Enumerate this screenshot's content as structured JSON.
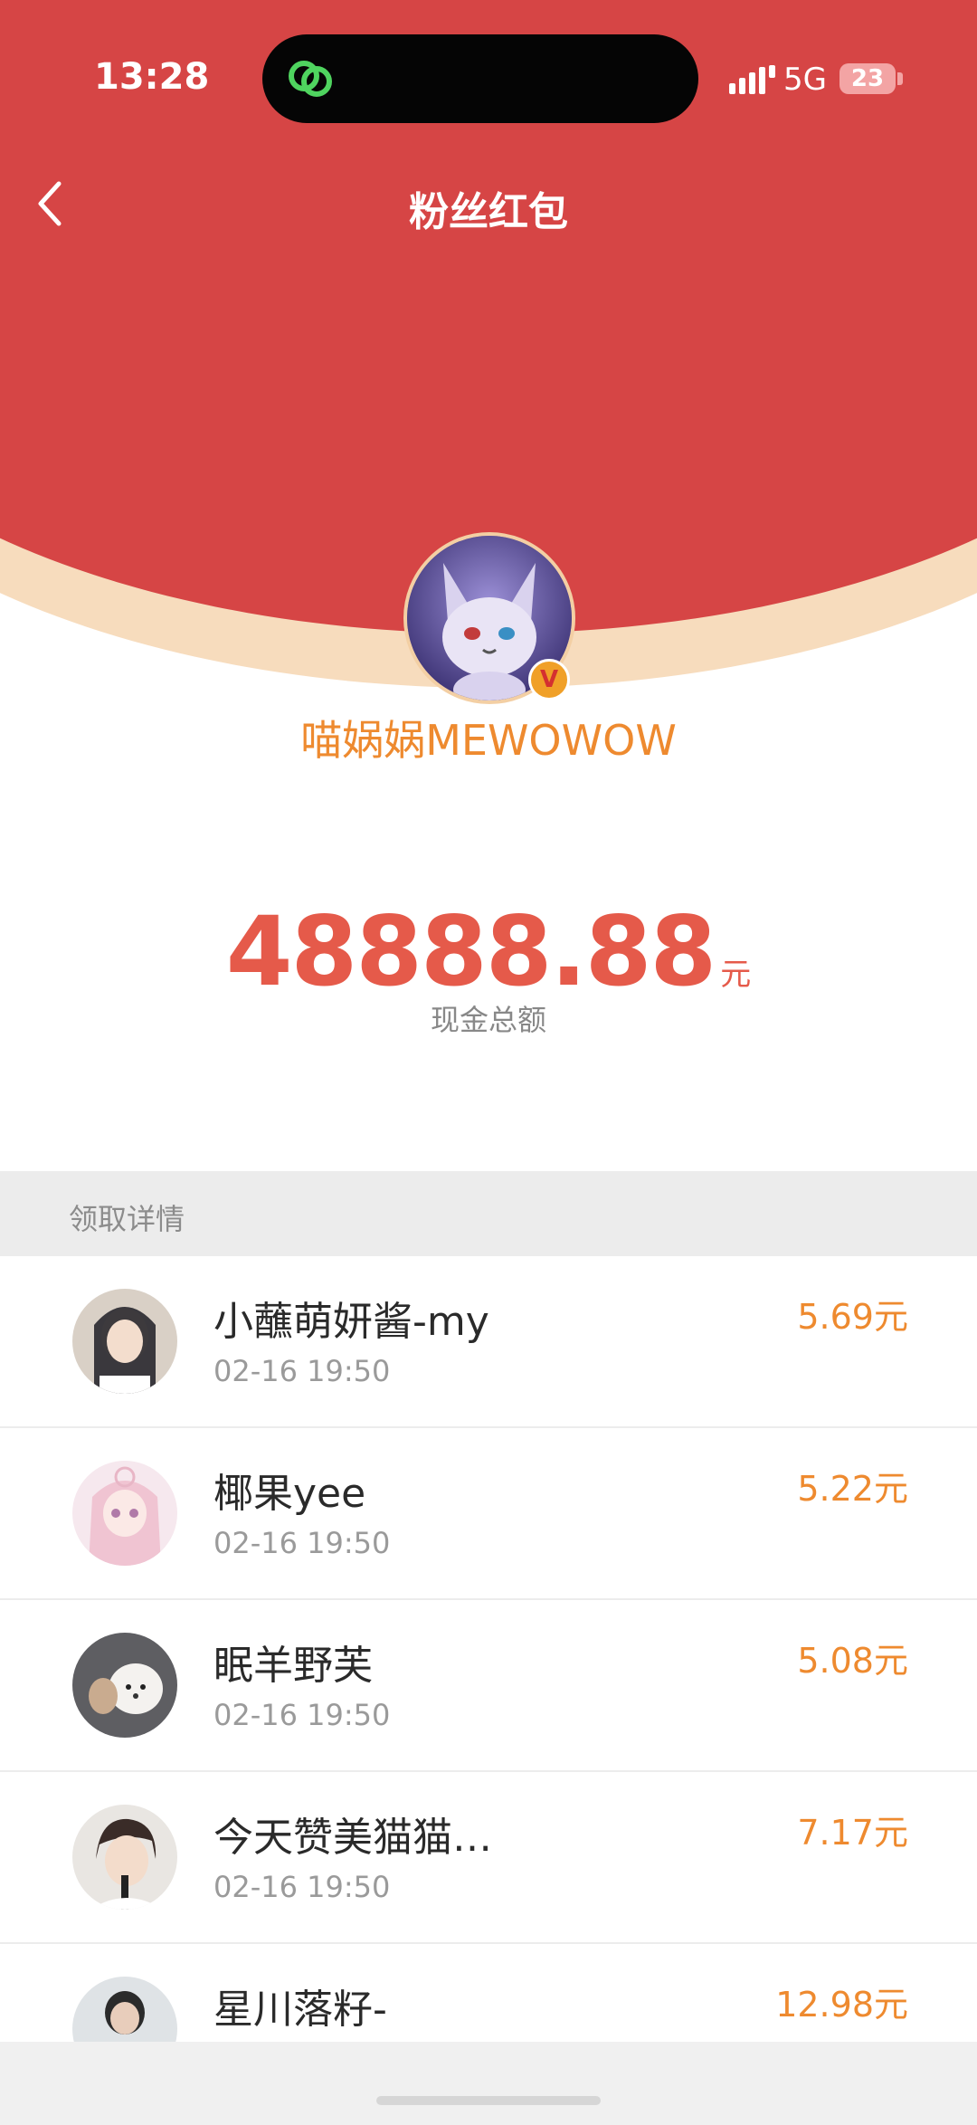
{
  "status_bar": {
    "time": "13:28",
    "network": "5G",
    "battery": "23"
  },
  "header": {
    "title": "粉丝红包",
    "background_color": "#d64545"
  },
  "sender": {
    "name": "喵娲娲MEWOWOW",
    "verified_badge": "V"
  },
  "summary": {
    "amount": "48888.88",
    "unit": "元",
    "label": "现金总额"
  },
  "details": {
    "section_label": "领取详情",
    "items": [
      {
        "name": "小蘸萌妍酱-my",
        "time": "02-16 19:50",
        "amount": "5.69元"
      },
      {
        "name": "椰果yee",
        "time": "02-16 19:50",
        "amount": "5.22元"
      },
      {
        "name": "眠羊野芙",
        "time": "02-16 19:50",
        "amount": "5.08元"
      },
      {
        "name": "今天赞美猫猫…",
        "time": "02-16 19:50",
        "amount": "7.17元"
      },
      {
        "name": "星川落籽-",
        "time": "",
        "amount": "12.98元"
      }
    ]
  },
  "colors": {
    "accent_orange": "#ee8a2f",
    "amount_red": "#e55a4a"
  }
}
